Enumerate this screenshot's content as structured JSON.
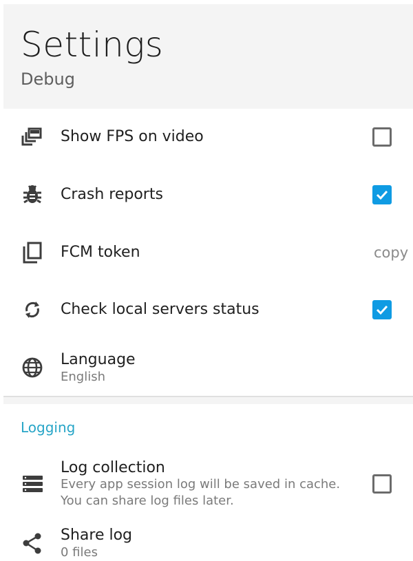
{
  "header": {
    "title": "Settings",
    "subtitle": "Debug"
  },
  "items": [
    {
      "label": "Show FPS on video",
      "icon": "picture-in-picture-icon",
      "control": "checkbox",
      "checked": false
    },
    {
      "label": "Crash reports",
      "icon": "bug-icon",
      "control": "checkbox",
      "checked": true
    },
    {
      "label": "FCM token",
      "icon": "copy-icon",
      "control": "action",
      "action_label": "copy"
    },
    {
      "label": "Check local servers status",
      "icon": "sync-icon",
      "control": "checkbox",
      "checked": true
    },
    {
      "label": "Language",
      "sublabel": "English",
      "icon": "globe-icon"
    }
  ],
  "logging": {
    "section_title": "Logging",
    "log_collection": {
      "label": "Log collection",
      "description_line1": "Every app session log will be saved in cache.",
      "description_line2": "You can share log files later.",
      "icon": "storage-icon",
      "checked": false
    },
    "share_log": {
      "label": "Share log",
      "sublabel": "0 files",
      "icon": "share-icon"
    }
  },
  "colors": {
    "accent": "#0f9be3",
    "section_title": "#27a5c7",
    "header_bg": "#f4f4f4"
  }
}
